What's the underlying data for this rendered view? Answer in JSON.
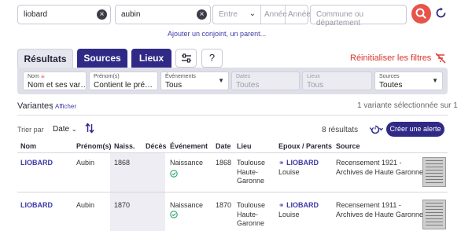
{
  "search": {
    "nom": "liobard",
    "prenom": "aubin",
    "entre_placeholder": "Entre",
    "annee1_placeholder": "Année",
    "annee2_placeholder": "Année",
    "lieu_placeholder": "Commune ou département",
    "spouse_link": "Ajouter un conjoint, un parent..."
  },
  "tabs": {
    "resultats": "Résultats",
    "sources": "Sources",
    "lieux": "Lieux",
    "help": "?",
    "reinit": "Réinitialiser les filtres"
  },
  "filters": [
    {
      "label": "Nom",
      "value": "Nom et ses var…"
    },
    {
      "label": "Prénom(s)",
      "value": "Contient le pré…"
    },
    {
      "label": "Événements",
      "value": "Tous"
    },
    {
      "label": "Dates",
      "value": "Toutes"
    },
    {
      "label": "Lieux",
      "value": "Tous"
    },
    {
      "label": "Sources",
      "value": "Toutes"
    }
  ],
  "variantes": {
    "label": "Variantes",
    "afficher": "Afficher",
    "count": "1 variante sélectionnée sur 1"
  },
  "sort": {
    "label": "Trier par",
    "value": "Date"
  },
  "results": {
    "count": "8 résultats",
    "alert_button": "Créer une alerte"
  },
  "columns": [
    "Nom",
    "Prénom(s)",
    "Naiss.",
    "Décès",
    "Événement",
    "Date",
    "Lieu",
    "Epoux / Parents",
    "Source"
  ],
  "rows": [
    {
      "nom": "LIOBARD",
      "prenom": "Aubin",
      "naiss": "1868",
      "deces": "",
      "evenement": "Naissance",
      "date": "1868",
      "lieu": [
        "Toulouse",
        "Haute-",
        "Garonne"
      ],
      "epoux_nom": "LIOBARD",
      "epoux_prenom": "Louise",
      "source": [
        "Recensement 1921 -",
        "Archives de Haute Garonne"
      ]
    },
    {
      "nom": "LIOBARD",
      "prenom": "Aubin",
      "naiss": "1870",
      "deces": "",
      "evenement": "Naissance",
      "date": "1870",
      "lieu": [
        "Toulouse",
        "Haute-",
        "Garonne"
      ],
      "epoux_nom": "LIOBARD",
      "epoux_prenom": "Louise",
      "source": [
        "Recensement 1911 -",
        "Archives de Haute Garonne"
      ]
    }
  ],
  "colors": {
    "primary": "#302a86",
    "accent_red": "#e8534a",
    "link": "#3e3aa8",
    "success": "#2aa36a"
  }
}
